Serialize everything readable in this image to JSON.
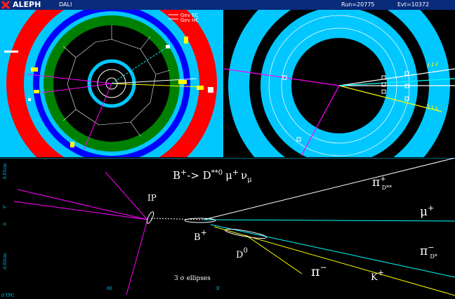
{
  "header": {
    "brand": "ALEPH",
    "app": "DALI",
    "run": "Run=20775",
    "event": "Evt=10372"
  },
  "legend": {
    "ec": "Gev EC",
    "hc": "Gev HC"
  },
  "physics": {
    "decay_prefix": "B",
    "decay_arrow": "-> D",
    "decay_dstar": "**0",
    "decay_mu": "μ",
    "decay_nu": "ν",
    "decay_sub": "μ",
    "ip": "IP",
    "b_plus": "B",
    "d0": "D",
    "d0_sup": "0",
    "pi_d_sup": "+",
    "pi_d_sub": "D**",
    "mu_label": "μ",
    "pi_dstar_sub": "D*",
    "pi_minus": "π",
    "k_plus": "K",
    "ellipses": "3 σ ellipses"
  },
  "axes": {
    "y_top": "0.05cm",
    "y_mid": "Y'",
    "y_zero": "0",
    "y_bottom": "-0.05cm",
    "x_tpc": "0 TPC",
    "x_left": "00",
    "x_right": "X'"
  },
  "colors": {
    "background": "#000000",
    "ecal": "#ff0000",
    "hcal": "#00c8ff",
    "coil": "#0000ff",
    "tpc": "#008000",
    "muon_track": "#00ffff",
    "pion_track": "#ff00ff",
    "kaon_track": "#ffff00"
  }
}
